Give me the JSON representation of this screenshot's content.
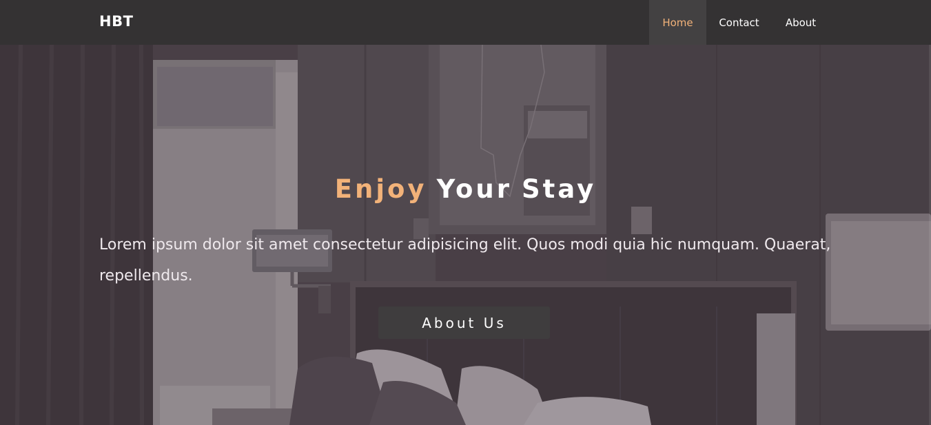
{
  "brand": {
    "name": "HBT"
  },
  "nav": {
    "items": [
      {
        "label": "Home",
        "active": true
      },
      {
        "label": "Contact",
        "active": false
      },
      {
        "label": "About",
        "active": false
      }
    ]
  },
  "hero": {
    "title_accent": "Enjoy",
    "title_word_1": "Your",
    "title_word_2": "Stay",
    "text": "Lorem ipsum dolor sit amet consectetur adipisicing elit. Quos modi quia hic numquam. Quaerat, repellendus.",
    "button_label": "About Us"
  },
  "colors": {
    "accent": "#f2b279",
    "navbar_bg": "#343233",
    "nav_active_bg": "#434142",
    "button_bg": "#3f3d3e",
    "overlay": "#3a2c36"
  }
}
